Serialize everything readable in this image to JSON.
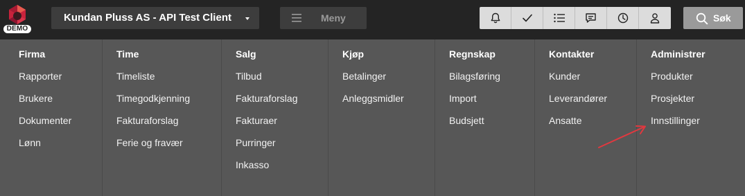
{
  "brand": {
    "badge": "DEMO"
  },
  "company": {
    "name": "Kundan Pluss AS - API Test Client"
  },
  "menu_button": {
    "label": "Meny"
  },
  "toolbar_icons": [
    "bell-icon",
    "check-icon",
    "list-icon",
    "chat-icon",
    "clock-icon",
    "user-icon"
  ],
  "search": {
    "label": "Søk"
  },
  "columns": [
    {
      "title": "Firma",
      "items": [
        "Rapporter",
        "Brukere",
        "Dokumenter",
        "Lønn"
      ]
    },
    {
      "title": "Time",
      "items": [
        "Timeliste",
        "Timegodkjenning",
        "Fakturaforslag",
        "Ferie og fravær"
      ]
    },
    {
      "title": "Salg",
      "items": [
        "Tilbud",
        "Fakturaforslag",
        "Fakturaer",
        "Purringer",
        "Inkasso"
      ]
    },
    {
      "title": "Kjøp",
      "items": [
        "Betalinger",
        "Anleggsmidler"
      ]
    },
    {
      "title": "Regnskap",
      "items": [
        "Bilagsføring",
        "Import",
        "Budsjett"
      ]
    },
    {
      "title": "Kontakter",
      "items": [
        "Kunder",
        "Leverandører",
        "Ansatte"
      ]
    },
    {
      "title": "Administrer",
      "items": [
        "Produkter",
        "Prosjekter",
        "Innstillinger"
      ]
    }
  ],
  "colors": {
    "topbar": "#242424",
    "menu_bg": "#575757",
    "annotation_arrow": "#e2383f",
    "logo": "#c8233c"
  }
}
